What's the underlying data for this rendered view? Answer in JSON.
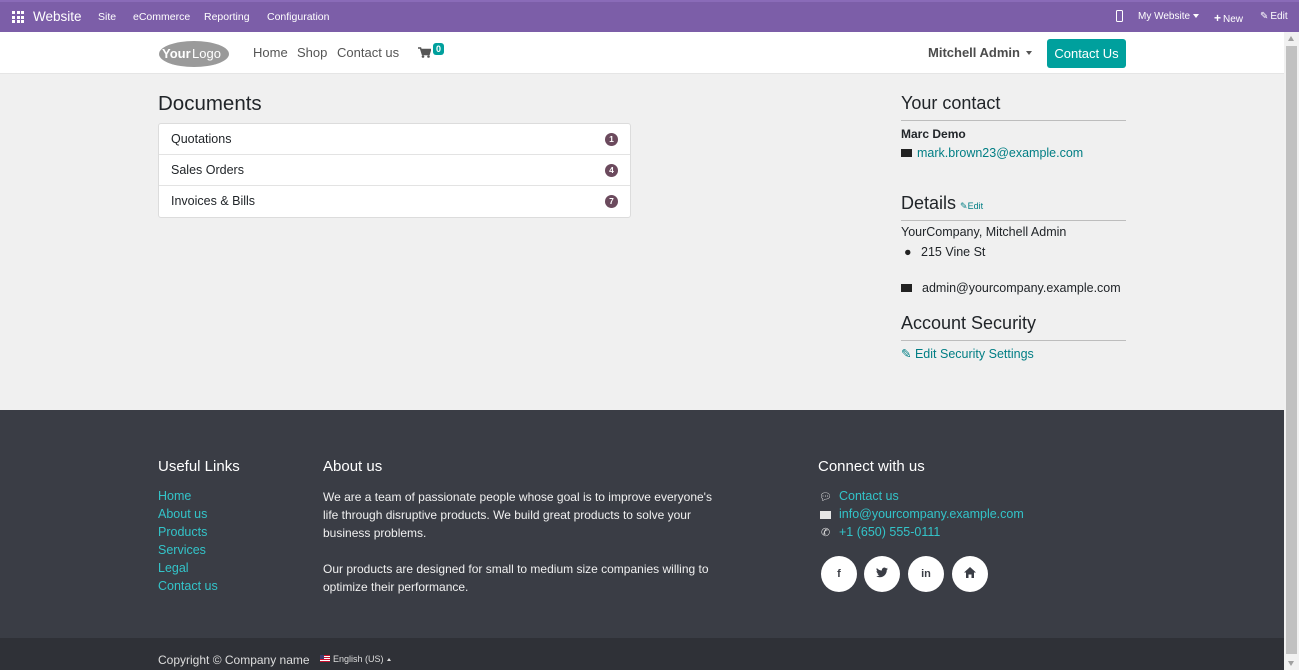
{
  "adminbar": {
    "brand": "Website",
    "menu": [
      "Site",
      "eCommerce",
      "Reporting",
      "Configuration"
    ],
    "my_website": "My Website",
    "new": "New",
    "edit": "Edit"
  },
  "header": {
    "logo_text_a": "Your",
    "logo_text_b": "Logo",
    "nav": [
      "Home",
      "Shop",
      "Contact us"
    ],
    "cart_count": "0",
    "user": "Mitchell Admin",
    "contact_button": "Contact Us"
  },
  "documents": {
    "title": "Documents",
    "items": [
      {
        "label": "Quotations",
        "count": "1"
      },
      {
        "label": "Sales Orders",
        "count": "4"
      },
      {
        "label": "Invoices & Bills",
        "count": "7"
      }
    ]
  },
  "contact": {
    "title": "Your contact",
    "name": "Marc Demo",
    "email": "mark.brown23@example.com"
  },
  "details": {
    "title": "Details",
    "edit": "Edit",
    "company": "YourCompany, Mitchell Admin",
    "address": "215 Vine St",
    "email": "admin@yourcompany.example.com"
  },
  "security": {
    "title": "Account Security",
    "link": "Edit Security Settings"
  },
  "footer": {
    "useful_title": "Useful Links",
    "useful_links": [
      "Home",
      "About us",
      "Products",
      "Services",
      "Legal",
      "Contact us"
    ],
    "about_title": "About us",
    "about_p1": "We are a team of passionate people whose goal is to improve everyone's life through disruptive products. We build great products to solve your business problems.",
    "about_p2": "Our products are designed for small to medium size companies willing to optimize their performance.",
    "connect_title": "Connect with us",
    "connect_contact": "Contact us",
    "connect_email": "info@yourcompany.example.com",
    "connect_phone": "+1 (650) 555-0111",
    "social": [
      "f",
      "t",
      "in",
      "home"
    ],
    "copyright": "Copyright © Company name",
    "language": "English (US)"
  },
  "colors": {
    "admin_bar": "#7c5ea8",
    "accent": "#00a09d",
    "link": "#017e84",
    "footer_bg": "#3a3d45",
    "footer_link": "#33c4c9"
  }
}
